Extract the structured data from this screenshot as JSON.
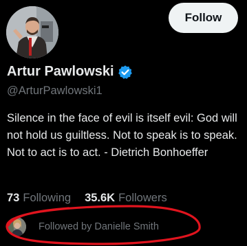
{
  "profile": {
    "name": "Artur Pawlowski",
    "handle": "@ArturPawlowski1",
    "verified_icon": "verified-badge-icon",
    "bio": "Silence in the face of evil is itself evil: God will not hold us guiltless. Not to speak is to speak. Not to act is to act. - Dietrich Bonhoeffer"
  },
  "follow_button": {
    "label": "Follow"
  },
  "stats": {
    "following_count": "73",
    "following_label": "Following",
    "followers_count": "35.6K",
    "followers_label": "Followers"
  },
  "followed_by": {
    "text": "Followed by Danielle Smith"
  },
  "colors": {
    "background": "#000000",
    "primary_text": "#e7e9ea",
    "secondary_text": "#71767b",
    "verified_blue": "#1d9bf0",
    "button_bg": "#eff3f4",
    "annotation_red": "#e0141e"
  }
}
